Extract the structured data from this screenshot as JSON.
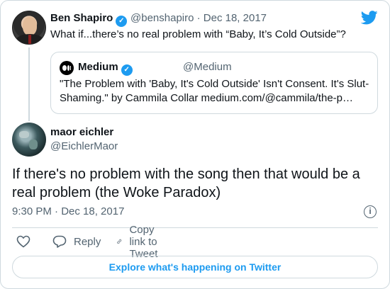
{
  "parent_tweet": {
    "author_name": "Ben Shapiro",
    "handle_date": "@benshapiro · Dec 18, 2017",
    "text": "What if...there’s no real problem with “Baby, It’s Cold Outside”?",
    "verified_icon": "check-badge-icon"
  },
  "quoted_tweet": {
    "author_name": "Medium",
    "handle": "@Medium",
    "line1": "\"The Problem with 'Baby, It's Cold Outside' Isn't Consent. It's Slut-",
    "line2": "Shaming.\" by Cammila Collar medium.com/@cammila/the-p…"
  },
  "main_tweet": {
    "author_name": "maor eichler",
    "handle": "@EichlerMaor",
    "text": "If there's no problem with the song then that would be a real problem (the Woke Paradox)",
    "timestamp": "9:30 PM · Dec 18, 2017"
  },
  "actions": {
    "reply_label": "Reply",
    "copy_label": "Copy link to Tweet"
  },
  "explore_label": "Explore what's happening on Twitter",
  "colors": {
    "accent": "#1d9bf0",
    "secondary_text": "#536471",
    "border": "#cfd9de"
  }
}
